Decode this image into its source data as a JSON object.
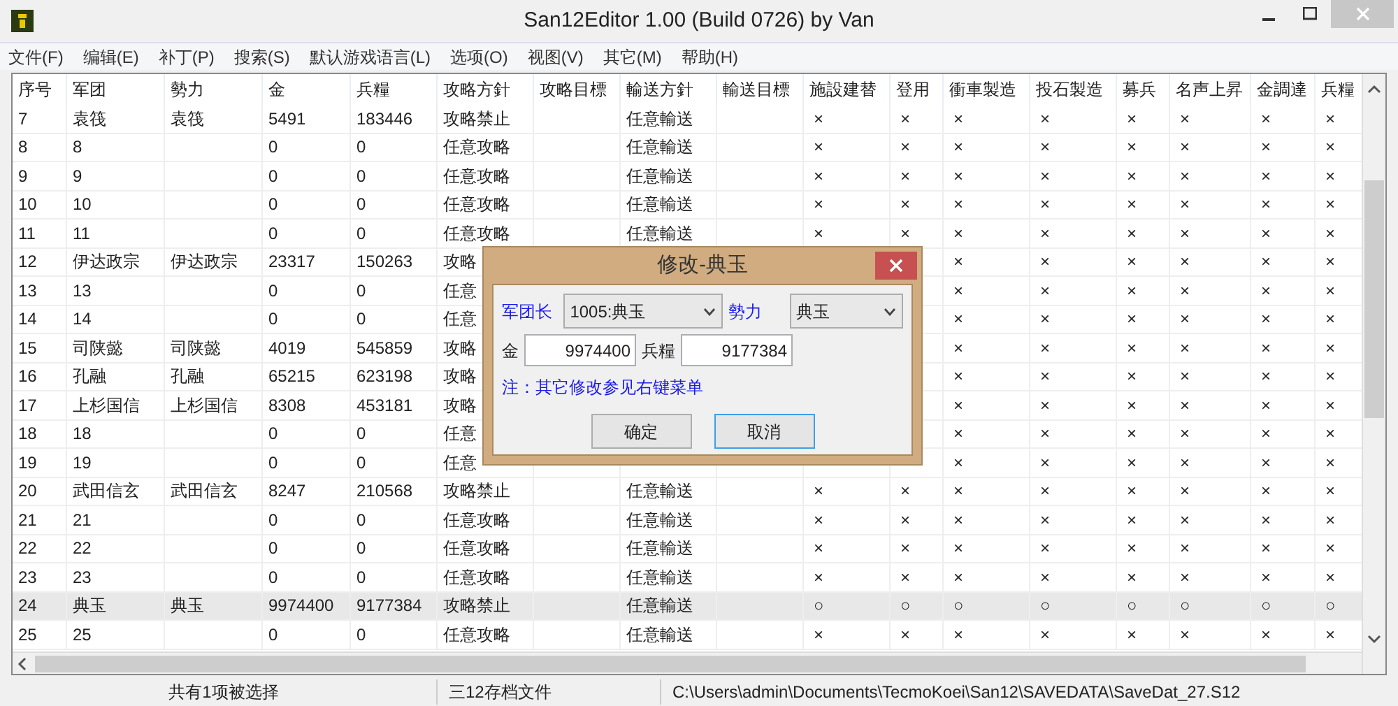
{
  "window": {
    "title": "San12Editor 1.00 (Build 0726) by Van"
  },
  "menu": [
    "文件(F)",
    "编辑(E)",
    "补丁(P)",
    "搜索(S)",
    "默认游戏语言(L)",
    "选项(O)",
    "视图(V)",
    "其它(M)",
    "帮助(H)"
  ],
  "table": {
    "columns": [
      "序号",
      "军团",
      "勢力",
      "金",
      "兵糧",
      "攻略方針",
      "攻略目標",
      "輸送方針",
      "輸送目標",
      "施設建替",
      "登用",
      "衝車製造",
      "投石製造",
      "募兵",
      "名声上昇",
      "金調達",
      "兵糧"
    ],
    "rows": [
      {
        "selected": false,
        "cells": [
          "7",
          "袁筏",
          "袁筏",
          "5491",
          "183446",
          "攻略禁止",
          null,
          "任意輸送",
          null,
          "×",
          "×",
          "×",
          "×",
          "×",
          "×",
          "×",
          "×"
        ]
      },
      {
        "selected": false,
        "cells": [
          "8",
          "8",
          null,
          "0",
          "0",
          "任意攻略",
          null,
          "任意輸送",
          null,
          "×",
          "×",
          "×",
          "×",
          "×",
          "×",
          "×",
          "×"
        ]
      },
      {
        "selected": false,
        "cells": [
          "9",
          "9",
          null,
          "0",
          "0",
          "任意攻略",
          null,
          "任意輸送",
          null,
          "×",
          "×",
          "×",
          "×",
          "×",
          "×",
          "×",
          "×"
        ]
      },
      {
        "selected": false,
        "cells": [
          "10",
          "10",
          null,
          "0",
          "0",
          "任意攻略",
          null,
          "任意輸送",
          null,
          "×",
          "×",
          "×",
          "×",
          "×",
          "×",
          "×",
          "×"
        ]
      },
      {
        "selected": false,
        "cells": [
          "11",
          "11",
          null,
          "0",
          "0",
          "任意攻略",
          null,
          "任意輸送",
          null,
          "×",
          "×",
          "×",
          "×",
          "×",
          "×",
          "×",
          "×"
        ]
      },
      {
        "selected": false,
        "cells": [
          "12",
          "伊达政宗",
          "伊达政宗",
          "23317",
          "150263",
          "攻略",
          null,
          null,
          null,
          null,
          null,
          "×",
          "×",
          "×",
          "×",
          "×",
          "×"
        ]
      },
      {
        "selected": false,
        "cells": [
          "13",
          "13",
          null,
          "0",
          "0",
          "任意",
          null,
          null,
          null,
          null,
          null,
          "×",
          "×",
          "×",
          "×",
          "×",
          "×"
        ]
      },
      {
        "selected": false,
        "cells": [
          "14",
          "14",
          null,
          "0",
          "0",
          "任意",
          null,
          null,
          null,
          null,
          null,
          "×",
          "×",
          "×",
          "×",
          "×",
          "×"
        ]
      },
      {
        "selected": false,
        "cells": [
          "15",
          "司陕懿",
          "司陕懿",
          "4019",
          "545859",
          "攻略",
          null,
          null,
          null,
          null,
          null,
          "×",
          "×",
          "×",
          "×",
          "×",
          "×"
        ]
      },
      {
        "selected": false,
        "cells": [
          "16",
          "孔融",
          "孔融",
          "65215",
          "623198",
          "攻略",
          null,
          null,
          null,
          null,
          null,
          "×",
          "×",
          "×",
          "×",
          "×",
          "×"
        ]
      },
      {
        "selected": false,
        "cells": [
          "17",
          "上杉国信",
          "上杉国信",
          "8308",
          "453181",
          "攻略",
          null,
          null,
          null,
          null,
          null,
          "×",
          "×",
          "×",
          "×",
          "×",
          "×"
        ]
      },
      {
        "selected": false,
        "cells": [
          "18",
          "18",
          null,
          "0",
          "0",
          "任意",
          null,
          null,
          null,
          null,
          null,
          "×",
          "×",
          "×",
          "×",
          "×",
          "×"
        ]
      },
      {
        "selected": false,
        "cells": [
          "19",
          "19",
          null,
          "0",
          "0",
          "任意",
          null,
          null,
          null,
          null,
          null,
          "×",
          "×",
          "×",
          "×",
          "×",
          "×"
        ]
      },
      {
        "selected": false,
        "cells": [
          "20",
          "武田信玄",
          "武田信玄",
          "8247",
          "210568",
          "攻略禁止",
          null,
          "任意輸送",
          null,
          "×",
          "×",
          "×",
          "×",
          "×",
          "×",
          "×",
          "×"
        ]
      },
      {
        "selected": false,
        "cells": [
          "21",
          "21",
          null,
          "0",
          "0",
          "任意攻略",
          null,
          "任意輸送",
          null,
          "×",
          "×",
          "×",
          "×",
          "×",
          "×",
          "×",
          "×"
        ]
      },
      {
        "selected": false,
        "cells": [
          "22",
          "22",
          null,
          "0",
          "0",
          "任意攻略",
          null,
          "任意輸送",
          null,
          "×",
          "×",
          "×",
          "×",
          "×",
          "×",
          "×",
          "×"
        ]
      },
      {
        "selected": false,
        "cells": [
          "23",
          "23",
          null,
          "0",
          "0",
          "任意攻略",
          null,
          "任意輸送",
          null,
          "×",
          "×",
          "×",
          "×",
          "×",
          "×",
          "×",
          "×"
        ]
      },
      {
        "selected": true,
        "cells": [
          "24",
          "典玉",
          "典玉",
          "9974400",
          "9177384",
          "攻略禁止",
          null,
          "任意輸送",
          null,
          "○",
          "○",
          "○",
          "○",
          "○",
          "○",
          "○",
          "○"
        ]
      },
      {
        "selected": false,
        "cells": [
          "25",
          "25",
          null,
          "0",
          "0",
          "任意攻略",
          null,
          "任意輸送",
          null,
          "×",
          "×",
          "×",
          "×",
          "×",
          "×",
          "×",
          "×"
        ]
      }
    ]
  },
  "dialog": {
    "title": "修改-典玉",
    "selects": [
      {
        "label": "军团长",
        "value": "1005:典玉"
      },
      {
        "label": "勢力",
        "value": "典玉"
      }
    ],
    "inputs": [
      {
        "label": "金",
        "value": "9974400"
      },
      {
        "label": "兵糧",
        "value": "9177384"
      }
    ],
    "note": "注：其它修改参见右键菜单",
    "buttons": [
      {
        "label": "确定",
        "default": false
      },
      {
        "label": "取消",
        "default": true
      }
    ]
  },
  "status_bar": [
    "共有1项被选择",
    "三12存档文件",
    "C:\\Users\\admin\\Documents\\TecmoKoei\\San12\\SAVEDATA\\SaveDat_27.S12"
  ]
}
